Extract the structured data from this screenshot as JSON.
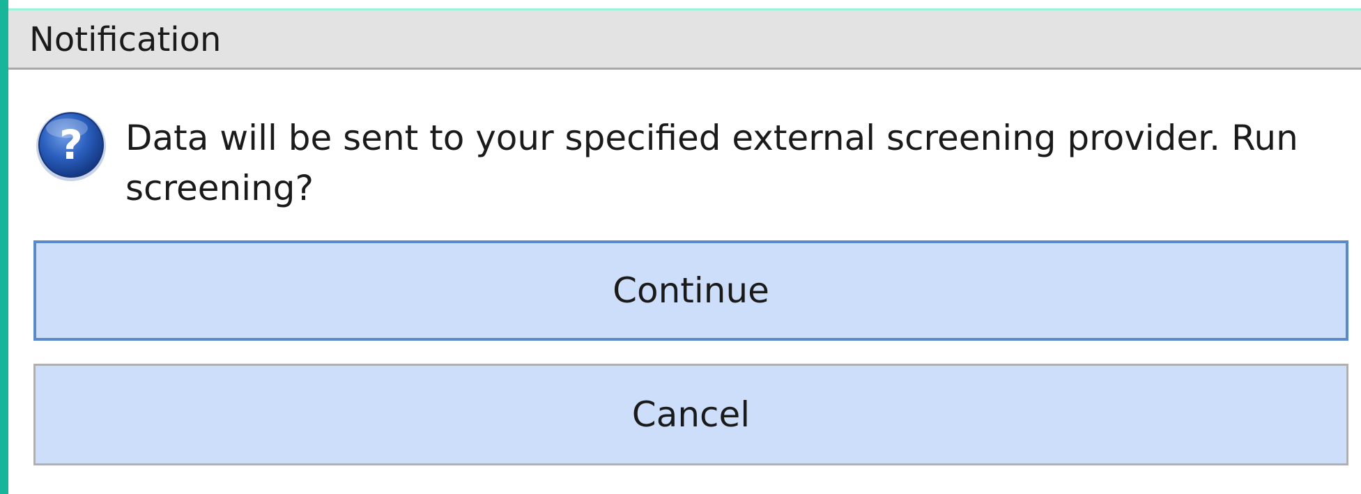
{
  "dialog": {
    "title": "Notification",
    "icon": "question-icon",
    "message": "Data will be sent to your specified external screening provider. Run screening?",
    "buttons": {
      "continue_label": "Continue",
      "cancel_label": "Cancel"
    }
  },
  "colors": {
    "accent_left": "#17b59a",
    "button_fill": "#cddefb",
    "button_default_border": "#5a89c7",
    "titlebar_bg": "#e3e3e3"
  }
}
